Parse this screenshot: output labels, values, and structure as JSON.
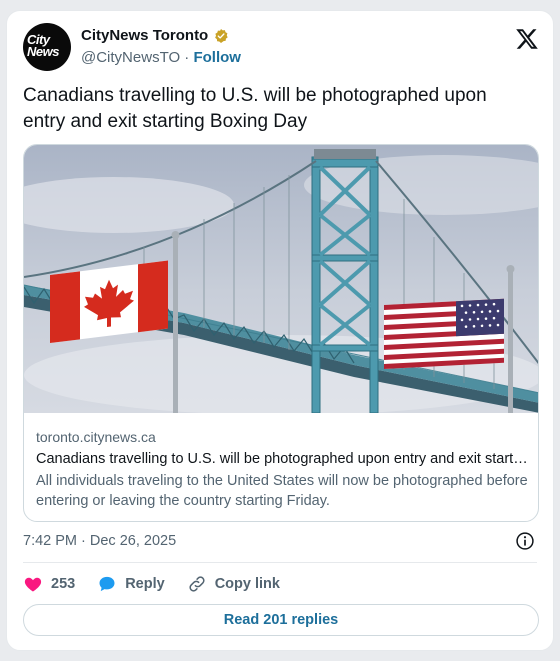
{
  "account": {
    "display_name": "CityNews Toronto",
    "handle": "@CityNewsTO",
    "separator": " · ",
    "follow_label": "Follow",
    "avatar_line1": "City",
    "avatar_line2": "News"
  },
  "tweet": {
    "text": "Canadians travelling to U.S. will be photographed upon entry and exit starting Boxing Day",
    "timestamp": "7:42 PM · Dec 26, 2025"
  },
  "link_card": {
    "domain": "toronto.citynews.ca",
    "title": "Canadians travelling to U.S. will be photographed upon entry and exit starting Boxing Day",
    "description": "All individuals traveling to the United States will now be photographed before entering or leaving the country starting Friday."
  },
  "actions": {
    "like_count": "253",
    "reply_label": "Reply",
    "copy_label": "Copy link"
  },
  "read_replies_label": "Read 201 replies",
  "icons": {
    "verified": "verified-badge-icon",
    "x_logo": "x-logo-icon",
    "info": "info-icon",
    "heart": "heart-icon",
    "reply": "reply-bubble-icon",
    "link": "link-icon"
  },
  "colors": {
    "link_blue": "#1d6f9b",
    "heart_pink": "#f91880",
    "verified_gold": "#c9a227",
    "muted_text": "#536471"
  }
}
